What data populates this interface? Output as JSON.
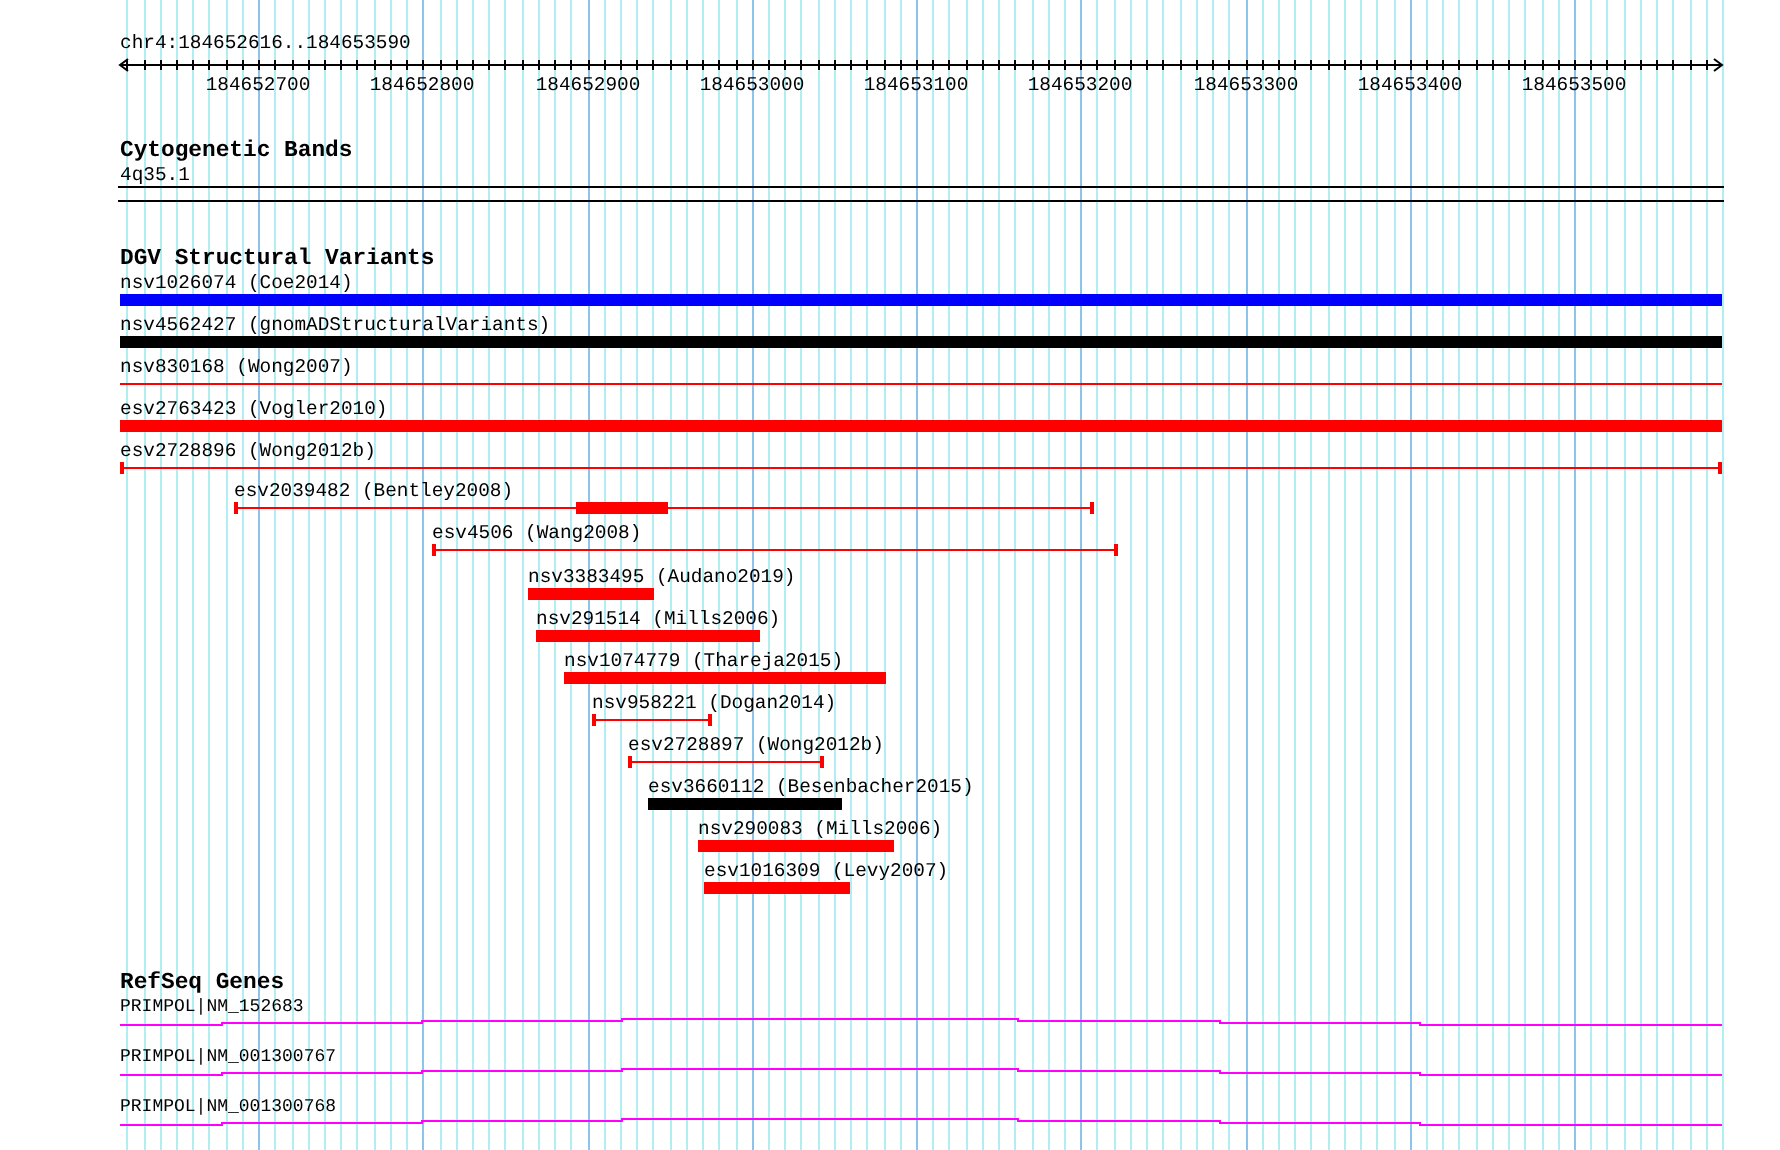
{
  "ruler": {
    "location": "chr4:184652616..184653590",
    "tick_labels": [
      "184652700",
      "184652800",
      "184652900",
      "184653000",
      "184653100",
      "184653200",
      "184653300",
      "184653400",
      "184653500"
    ]
  },
  "cytogenetic_bands": {
    "title": "Cytogenetic Bands",
    "band": "4q35.1"
  },
  "dgv_structural_variants": {
    "title": "DGV Structural Variants",
    "variants": [
      {
        "label": "nsv1026074 (Coe2014)",
        "kind": "bar",
        "color": "#0000ff"
      },
      {
        "label": "nsv4562427 (gnomADStructuralVariants)",
        "kind": "bar",
        "color": "#000000"
      },
      {
        "label": "nsv830168 (Wong2007)",
        "kind": "line",
        "color": "#ff0000"
      },
      {
        "label": "esv2763423 (Vogler2010)",
        "kind": "bar",
        "color": "#ff0000"
      },
      {
        "label": "esv2728896 (Wong2012b)",
        "kind": "capped_line",
        "color": "#ff0000"
      },
      {
        "label": "esv2039482 (Bentley2008)",
        "kind": "capped_line_with_bar",
        "color": "#ff0000"
      },
      {
        "label": "esv4506 (Wang2008)",
        "kind": "capped_line",
        "color": "#ff0000"
      },
      {
        "label": "nsv3383495 (Audano2019)",
        "kind": "bar",
        "color": "#ff0000"
      },
      {
        "label": "nsv291514 (Mills2006)",
        "kind": "bar",
        "color": "#ff0000"
      },
      {
        "label": "nsv1074779 (Thareja2015)",
        "kind": "bar",
        "color": "#ff0000"
      },
      {
        "label": "nsv958221 (Dogan2014)",
        "kind": "capped_line",
        "color": "#ff0000"
      },
      {
        "label": "esv2728897 (Wong2012b)",
        "kind": "capped_line",
        "color": "#ff0000"
      },
      {
        "label": "esv3660112 (Besenbacher2015)",
        "kind": "bar",
        "color": "#000000"
      },
      {
        "label": "nsv290083 (Mills2006)",
        "kind": "bar",
        "color": "#ff0000"
      },
      {
        "label": "esv1016309 (Levy2007)",
        "kind": "bar",
        "color": "#ff0000"
      }
    ]
  },
  "refseq_genes": {
    "title": "RefSeq Genes",
    "genes": [
      {
        "label": "PRIMPOL|NM_152683"
      },
      {
        "label": "PRIMPOL|NM_001300767"
      },
      {
        "label": "PRIMPOL|NM_001300768"
      }
    ]
  }
}
